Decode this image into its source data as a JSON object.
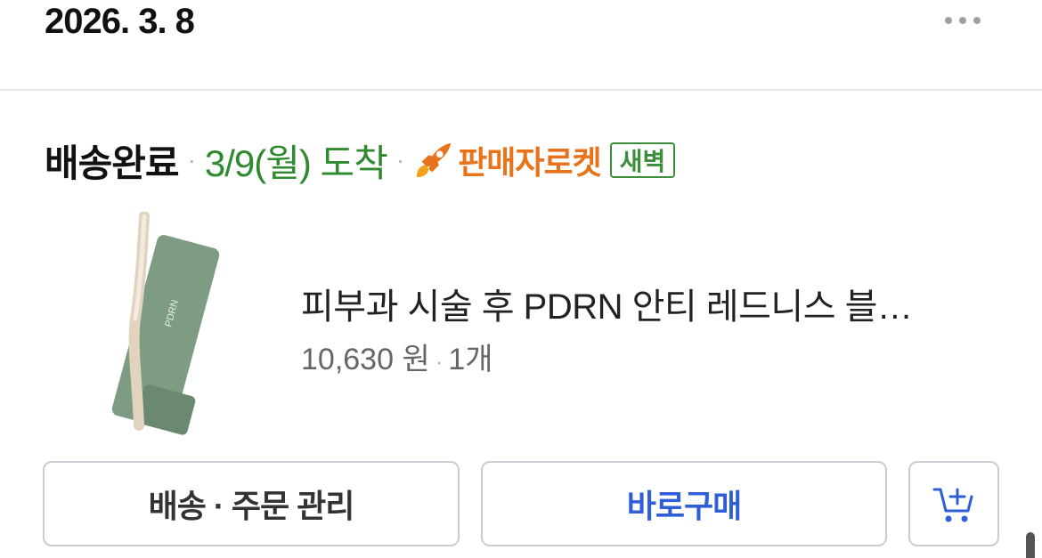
{
  "order": {
    "date": "2026. 3. 8"
  },
  "status": {
    "label": "배송완료",
    "arrival": "3/9(월) 도착",
    "separator": "·",
    "delivery_type": "판매자로켓",
    "delivery_badge": "새벽"
  },
  "product": {
    "name": "피부과 시술 후 PDRN 안티 레드니스 블…",
    "price": "10,630 원",
    "separator": "·",
    "quantity": "1개",
    "image_text": "PDRN"
  },
  "buttons": {
    "manage": "배송 · 주문 관리",
    "buy_again": "바로구매"
  },
  "icons": {
    "more": "more-horizontal-icon",
    "rocket": "rocket-icon",
    "cart_add": "cart-add-icon"
  },
  "colors": {
    "arrival_green": "#2f8a2f",
    "rocket_orange": "#e8731a",
    "badge_green": "#3b8e3b",
    "buy_blue": "#2f5fd6"
  }
}
